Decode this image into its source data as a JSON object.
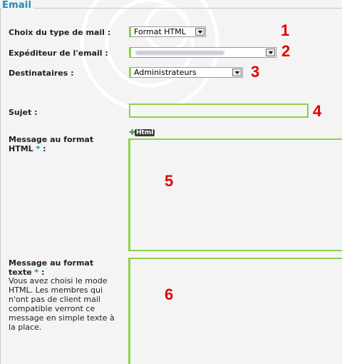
{
  "section": {
    "title": "Email"
  },
  "fields": {
    "mail_type": {
      "label": "Choix du type de mail :",
      "value": "Format HTML",
      "marker": "1"
    },
    "sender": {
      "label": "Expéditeur de l'email :",
      "value": "",
      "marker": "2"
    },
    "recipients": {
      "label": "Destinataires :",
      "value": "Administrateurs",
      "marker": "3"
    },
    "subject": {
      "label": "Sujet :",
      "value": "",
      "marker": "4"
    },
    "html_message": {
      "label_line1": "Message au format",
      "label_line2": "HTML",
      "required": "*",
      "marker": "5",
      "icon_text": "Html"
    },
    "text_message": {
      "label_line1": "Message au format",
      "label_line2": "texte",
      "required": "*",
      "marker": "6",
      "help": "Vous avez choisi le mode HTML. Les membres qui n'ont pas de client mail compatible verront ce message en simple texte à la place."
    }
  },
  "colors": {
    "accent": "#1f8ab7",
    "field_border": "#8cd24a",
    "marker": "#e00000"
  }
}
